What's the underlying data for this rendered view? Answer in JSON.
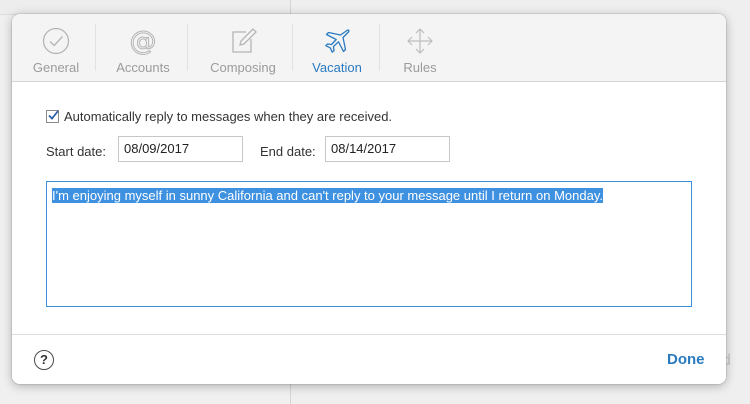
{
  "tabs": [
    {
      "label": "General",
      "icon": "checkmark-circle-icon",
      "active": false
    },
    {
      "label": "Accounts",
      "icon": "at-sign-icon",
      "active": false
    },
    {
      "label": "Composing",
      "icon": "compose-icon",
      "active": false
    },
    {
      "label": "Vacation",
      "icon": "airplane-icon",
      "active": true
    },
    {
      "label": "Rules",
      "icon": "move-arrows-icon",
      "active": false
    }
  ],
  "vacation": {
    "auto_reply_checked": true,
    "auto_reply_label": "Automatically reply to messages when they are received.",
    "start_date_label": "Start date:",
    "start_date_value": "08/09/2017",
    "end_date_label": "End date:",
    "end_date_value": "08/14/2017",
    "message": "I'm enjoying myself in sunny California and can't reply to your message until I return on Monday."
  },
  "footer": {
    "help_label": "?",
    "done_label": "Done"
  },
  "colors": {
    "accent": "#2a7ac0",
    "inactive_tab": "#9b9b9b",
    "selection": "#3e90e0"
  }
}
